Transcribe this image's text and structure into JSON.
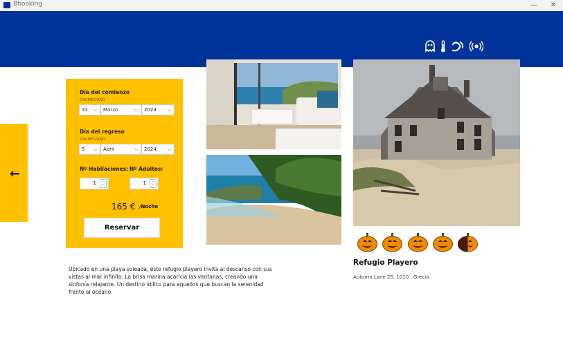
{
  "window": {
    "title": "Bhooking",
    "minimize_icon": "—",
    "close_icon": "✕"
  },
  "header": {
    "icons": [
      "ghost-icon",
      "thermometer-icon",
      "wave-icon",
      "wireless-icon"
    ]
  },
  "back_icon": "←",
  "form": {
    "start_label": "Día del comienzo",
    "start_format": "DIA/MES/AÑO",
    "start_day": "31",
    "start_month": "Marzo",
    "start_year": "2024",
    "end_label": "Día del regreso",
    "end_format": "DIA/MES/AÑO",
    "end_day": "5",
    "end_month": "Abril",
    "end_year": "2024",
    "rooms_label": "Nº Habilaciones:",
    "rooms_value": "1",
    "adults_label": "Nº Adultos:",
    "adults_value": "1",
    "price": "165 €",
    "price_unit": "/Noche",
    "reserve_label": "Reservar"
  },
  "hotel": {
    "name": "Refugio Playero",
    "address": "Autumn Lane 25, 1010 , Grecia",
    "description": "Ubicado en una playa soleada, este refugio playero invita al descanso con sus vistas al mar infinito. La brisa marina acaricia las ventanas, creando una sinfonía relajante. Un destino idílico para aquellos que buscan la serenidad frente al océano",
    "rating": 4.5,
    "rating_max": 5
  }
}
